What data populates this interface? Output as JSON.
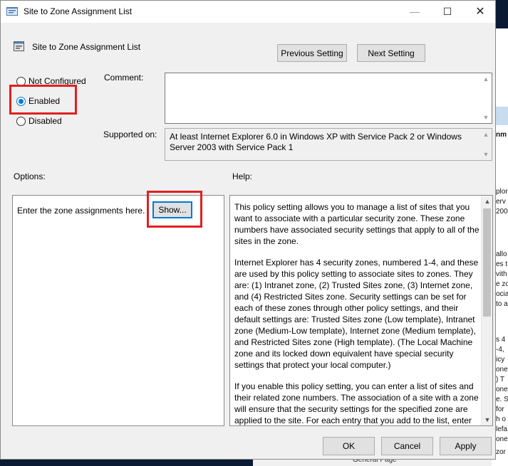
{
  "window": {
    "title": "Site to Zone Assignment List"
  },
  "header": {
    "policy_name": "Site to Zone Assignment List",
    "previous_label": "Previous Setting",
    "next_label": "Next Setting"
  },
  "state": {
    "options": [
      "Not Configured",
      "Enabled",
      "Disabled"
    ],
    "selected": "Enabled"
  },
  "comment": {
    "label": "Comment:",
    "value": ""
  },
  "supported": {
    "label": "Supported on:",
    "value": "At least Internet Explorer 6.0 in Windows XP with Service Pack 2 or Windows Server 2003 with Service Pack 1"
  },
  "options_section": {
    "label": "Options:",
    "zone_text": "Enter the zone assignments here.",
    "show_label": "Show..."
  },
  "help_section": {
    "label": "Help:",
    "paragraphs": [
      "This policy setting allows you to manage a list of sites that you want to associate with a particular security zone. These zone numbers have associated security settings that apply to all of the sites in the zone.",
      "Internet Explorer has 4 security zones, numbered 1-4, and these are used by this policy setting to associate sites to zones. They are: (1) Intranet zone, (2) Trusted Sites zone, (3) Internet zone, and (4) Restricted Sites zone. Security settings can be set for each of these zones through other policy settings, and their default settings are: Trusted Sites zone (Low template), Intranet zone (Medium-Low template), Internet zone (Medium template), and Restricted Sites zone (High template). (The Local Machine zone and its locked down equivalent have special security settings that protect your local computer.)",
      "If you enable this policy setting, you can enter a list of sites and their related zone numbers. The association of a site with a zone will ensure that the security settings for the specified zone are applied to the site.  For each entry that you add to the list, enter the following information:"
    ]
  },
  "footer": {
    "ok_label": "OK",
    "cancel_label": "Cancel",
    "apply_label": "Apply"
  },
  "background_window": {
    "fragments": [
      "nm",
      "plor",
      "erv",
      "200",
      "allo",
      "es t",
      "vith",
      "e zo",
      "ocia",
      "to a",
      "s 4",
      "-4,",
      "icy",
      "one",
      ") T",
      "one",
      "e. S",
      "for",
      "h o",
      "lefa",
      "one",
      "zor"
    ],
    "bottom_text": "General Page"
  },
  "colors": {
    "accent": "#0078d7",
    "highlight": "#e02020"
  }
}
